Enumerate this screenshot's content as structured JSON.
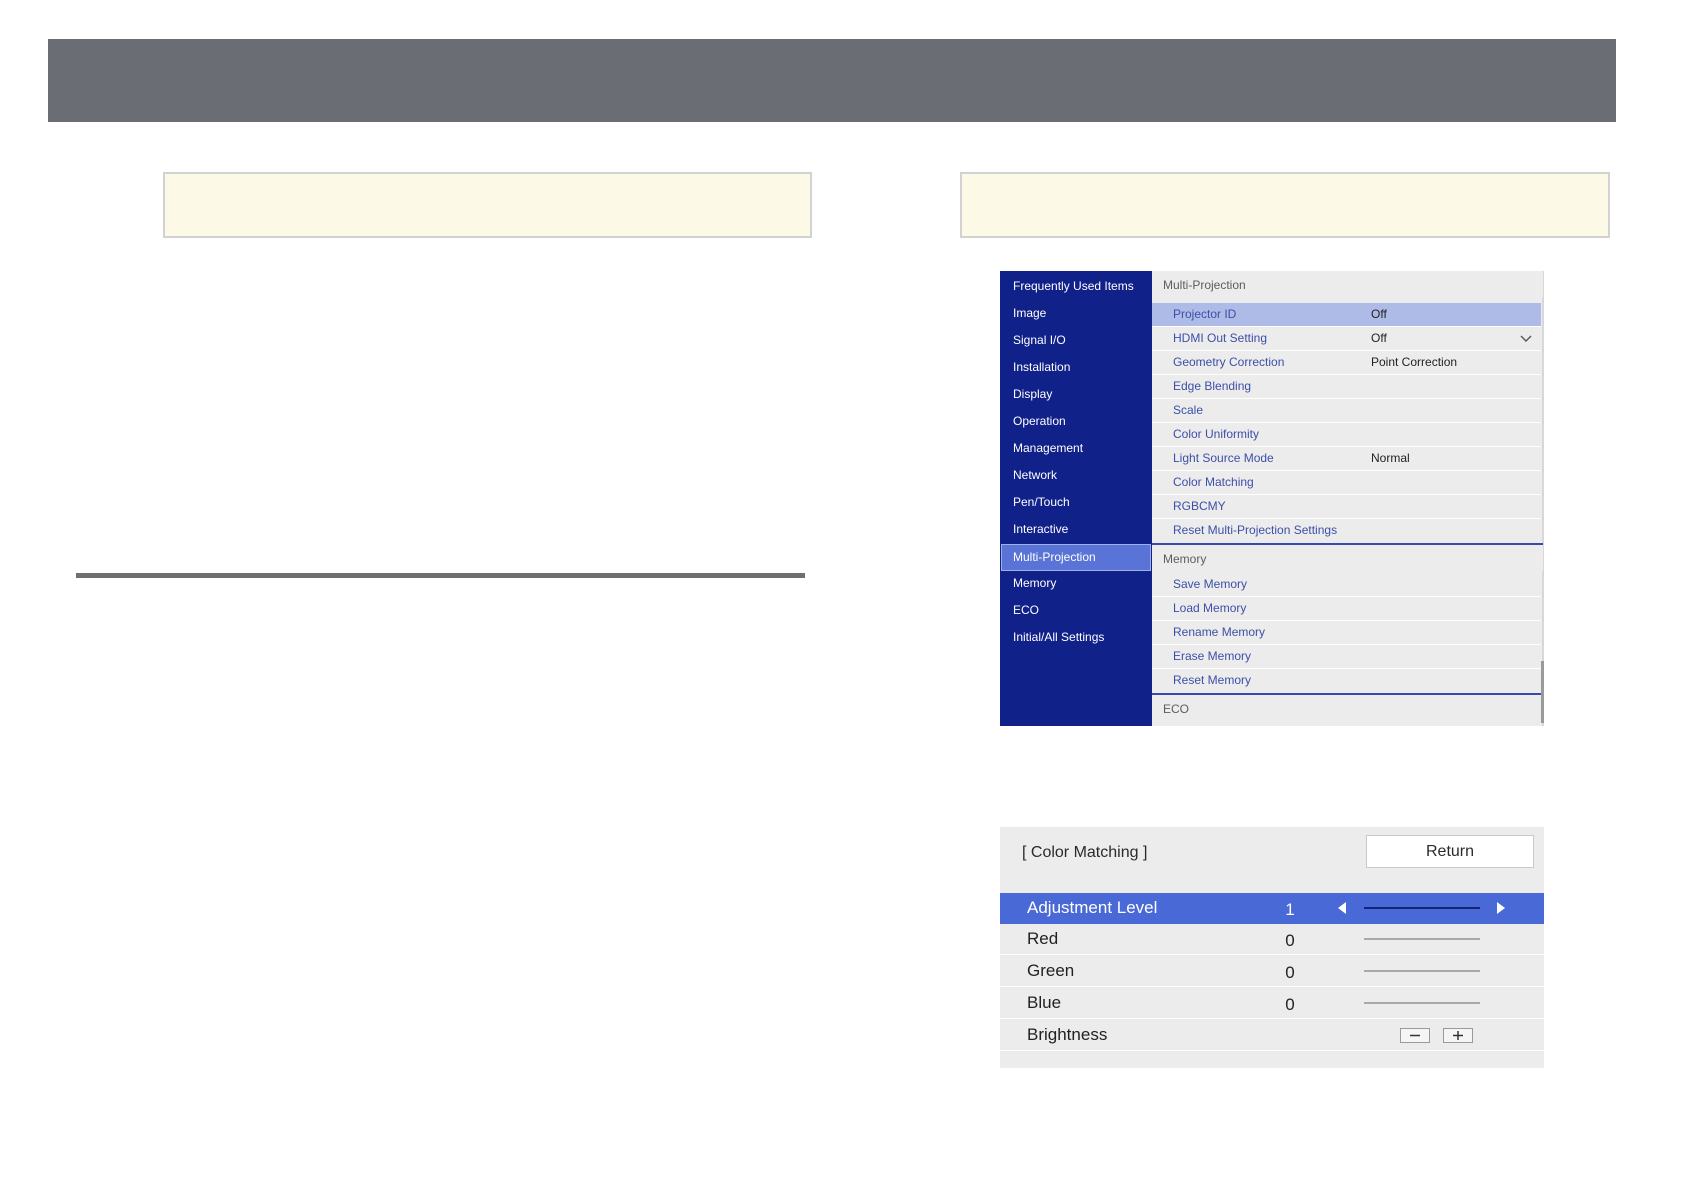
{
  "menu": {
    "left_items": [
      "Frequently Used Items",
      "Image",
      "Signal I/O",
      "Installation",
      "Display",
      "Operation",
      "Management",
      "Network",
      "Pen/Touch",
      "Interactive",
      "Multi-Projection",
      "Memory",
      "ECO",
      "Initial/All Settings"
    ],
    "selected_left_item": "Multi-Projection",
    "sections": [
      {
        "header": "Multi-Projection",
        "rows": [
          {
            "label": "Projector ID",
            "value": "Off",
            "highlighted": true
          },
          {
            "label": "HDMI Out Setting",
            "value": "Off",
            "dropdown": true
          },
          {
            "label": "Geometry Correction",
            "value": "Point Correction"
          },
          {
            "label": "Edge Blending",
            "value": ""
          },
          {
            "label": "Scale",
            "value": ""
          },
          {
            "label": "Color Uniformity",
            "value": ""
          },
          {
            "label": "Light Source Mode",
            "value": "Normal"
          },
          {
            "label": "Color Matching",
            "value": ""
          },
          {
            "label": "RGBCMY",
            "value": ""
          },
          {
            "label": "Reset Multi-Projection Settings",
            "value": ""
          }
        ]
      },
      {
        "header": "Memory",
        "rows": [
          {
            "label": "Save Memory",
            "value": ""
          },
          {
            "label": "Load Memory",
            "value": ""
          },
          {
            "label": "Rename Memory",
            "value": ""
          },
          {
            "label": "Erase Memory",
            "value": ""
          },
          {
            "label": "Reset Memory",
            "value": ""
          }
        ]
      },
      {
        "header": "ECO",
        "rows": []
      }
    ]
  },
  "color_matching": {
    "title": "[ Color Matching ]",
    "return_label": "Return",
    "rows": [
      {
        "label": "Adjustment Level",
        "value": "1",
        "highlighted": true,
        "control": "slider-with-arrows"
      },
      {
        "label": "Red",
        "value": "0",
        "control": "slider"
      },
      {
        "label": "Green",
        "value": "0",
        "control": "slider"
      },
      {
        "label": "Blue",
        "value": "0",
        "control": "slider"
      },
      {
        "label": "Brightness",
        "value": "",
        "control": "minus-plus"
      }
    ]
  },
  "colors": {
    "topbar": "#6a6d74",
    "note_fill": "#fdf9e7",
    "menu_sidebar": "#102189",
    "menu_selected": "#5a73d6",
    "row_highlight": "#aebbe7",
    "cm_highlight": "#4869d6"
  },
  "icons": {
    "dropdown": "chevron-down-icon",
    "left_arrow": "triangle-left-icon",
    "right_arrow": "triangle-right-icon",
    "minus": "minus-icon",
    "plus": "plus-icon"
  }
}
